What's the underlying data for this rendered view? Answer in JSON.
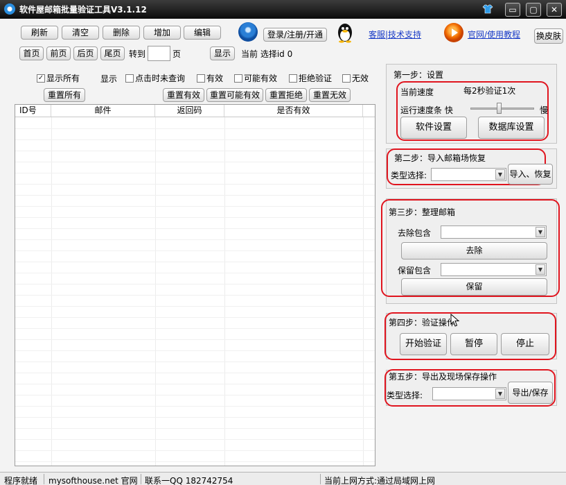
{
  "window": {
    "title": "软件屋邮箱批量验证工具V3.1.12",
    "min_glyph": "▭",
    "max_glyph": "▢",
    "close_glyph": "✕"
  },
  "toolbar": {
    "refresh": "刷新",
    "clear": "清空",
    "delete": "删除",
    "add": "增加",
    "edit": "编辑",
    "login": "登录/注册/开通",
    "support_link": "客服|技术支持",
    "website_link": "官网/使用教程",
    "skin": "换皮肤"
  },
  "pager": {
    "first": "首页",
    "prev": "前页",
    "next": "后页",
    "last": "尾页",
    "goto_label": "转到",
    "goto_value": "",
    "page_label": "页",
    "show": "显示",
    "current_label": "当前 选择id 0"
  },
  "filters": {
    "show_all": "显示所有",
    "show_label": "显示",
    "unchecked": "点击时未查询",
    "valid": "有效",
    "maybe": "可能有效",
    "rejected": "拒绝验证",
    "invalid": "无效",
    "check_mark": "✓"
  },
  "resets": {
    "all": "重置所有",
    "valid": "重置有效",
    "maybe": "重置可能有效",
    "rejected": "重置拒绝",
    "invalid": "重置无效"
  },
  "table": {
    "columns": [
      "ID号",
      "邮件",
      "返回码",
      "是否有效"
    ]
  },
  "step1": {
    "title": "第一步：设置",
    "speed_label": "当前速度",
    "speed_value": "每2秒验证1次",
    "bar_label": "运行速度条 快",
    "slow": "慢",
    "slider_level": 0.45,
    "software_settings": "软件设置",
    "db_settings": "数据库设置"
  },
  "step2": {
    "title": "第二步：导入邮箱场恢复",
    "type_label": "类型选择:",
    "type_value": "",
    "import_button": "导入、恢复"
  },
  "step3": {
    "title": "第三步：整理邮箱",
    "remove_label": "去除包含",
    "remove_value": "",
    "remove_button": "去除",
    "keep_label": "保留包含",
    "keep_value": "",
    "keep_button": "保留"
  },
  "step4": {
    "title": "第四步：验证操作",
    "start": "开始验证",
    "pause": "暂停",
    "stop": "停止"
  },
  "step5": {
    "title": "第五步：导出及现场保存操作",
    "type_label": "类型选择:",
    "type_value": "",
    "export_button": "导出/保存"
  },
  "status": {
    "ready": "程序就绪",
    "website": "mysofthouse.net 官网",
    "contact": "联系一QQ 182742754",
    "network": "当前上网方式:通过局域网上网"
  },
  "colors": {
    "highlight": "#e0141e",
    "link": "#1a3cc7"
  }
}
